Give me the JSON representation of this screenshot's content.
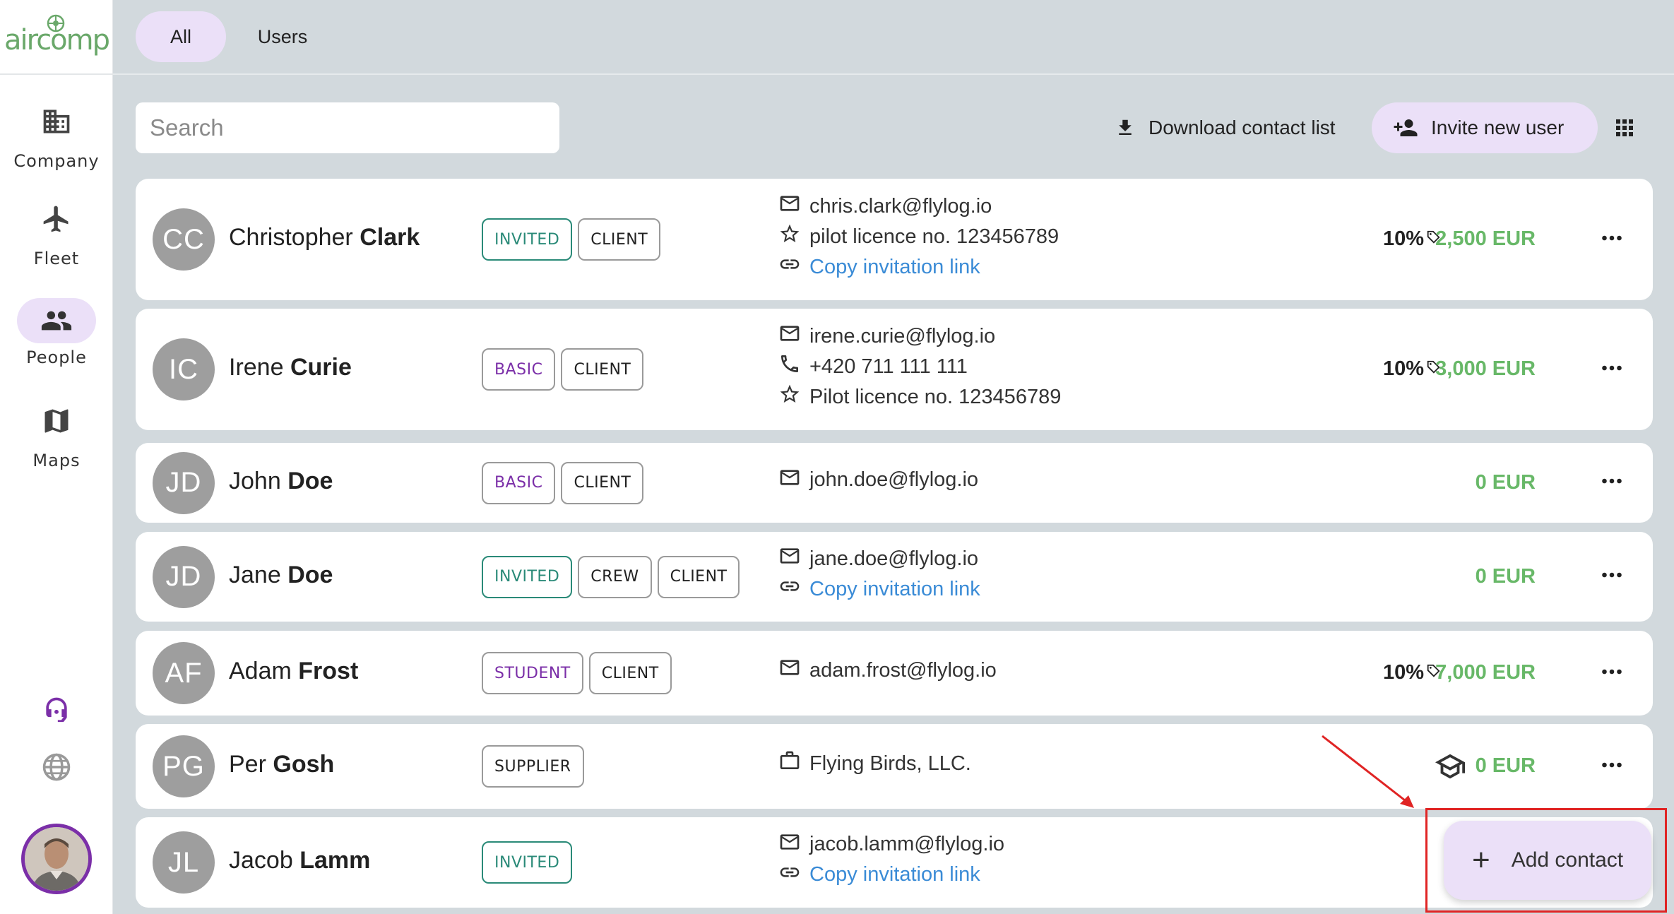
{
  "app": {
    "logo": "aircomp",
    "brand_color": "#6aa86a",
    "accent": "#ebe0f8"
  },
  "tabs": [
    {
      "label": "All",
      "active": true
    },
    {
      "label": "Users",
      "active": false
    }
  ],
  "sidebar": {
    "items": [
      {
        "label": "Company",
        "icon": "building-icon"
      },
      {
        "label": "Fleet",
        "icon": "airplane-icon"
      },
      {
        "label": "People",
        "icon": "people-icon",
        "active": true
      },
      {
        "label": "Maps",
        "icon": "map-icon"
      }
    ],
    "bottom_icons": [
      "support-icon",
      "globe-icon"
    ]
  },
  "search": {
    "placeholder": "Search",
    "value": ""
  },
  "toolbar": {
    "download_label": "Download contact list",
    "invite_label": "Invite new user"
  },
  "contacts": [
    {
      "initials": "CC",
      "first": "Christopher",
      "last": "Clark",
      "badges": [
        "INVITED",
        "CLIENT"
      ],
      "info": [
        {
          "icon": "mail-icon",
          "text": "chris.clark@flylog.io"
        },
        {
          "icon": "star-icon",
          "text": "pilot licence no. 123456789"
        },
        {
          "icon": "link-icon",
          "text": "Copy invitation link",
          "link": true
        }
      ],
      "discount": "10%",
      "amount": "2,500 EUR"
    },
    {
      "initials": "IC",
      "first": "Irene",
      "last": "Curie",
      "badges": [
        "BASIC",
        "CLIENT"
      ],
      "info": [
        {
          "icon": "mail-icon",
          "text": "irene.curie@flylog.io"
        },
        {
          "icon": "phone-icon",
          "text": "+420 711 111 111"
        },
        {
          "icon": "star-icon",
          "text": "Pilot licence no. 123456789"
        }
      ],
      "discount": "10%",
      "amount": "3,000 EUR"
    },
    {
      "initials": "JD",
      "first": "John",
      "last": "Doe",
      "badges": [
        "BASIC",
        "CLIENT"
      ],
      "info": [
        {
          "icon": "mail-icon",
          "text": "john.doe@flylog.io"
        }
      ],
      "discount": "",
      "amount": "0 EUR"
    },
    {
      "initials": "JD",
      "first": "Jane",
      "last": "Doe",
      "badges": [
        "INVITED",
        "CREW",
        "CLIENT"
      ],
      "info": [
        {
          "icon": "mail-icon",
          "text": "jane.doe@flylog.io"
        },
        {
          "icon": "link-icon",
          "text": "Copy invitation link",
          "link": true
        }
      ],
      "discount": "",
      "amount": "0 EUR"
    },
    {
      "initials": "AF",
      "first": "Adam",
      "last": "Frost",
      "badges": [
        "STUDENT",
        "CLIENT"
      ],
      "info": [
        {
          "icon": "mail-icon",
          "text": "adam.frost@flylog.io"
        }
      ],
      "discount": "10%",
      "amount": "7,000 EUR"
    },
    {
      "initials": "PG",
      "first": "Per",
      "last": "Gosh",
      "badges": [
        "SUPPLIER"
      ],
      "info": [
        {
          "icon": "briefcase-icon",
          "text": "Flying Birds, LLC."
        }
      ],
      "discount": "",
      "amount": "0 EUR",
      "extra_icon": "graduation-cap-icon"
    },
    {
      "initials": "JL",
      "first": "Jacob",
      "last": "Lamm",
      "badges": [
        "INVITED"
      ],
      "info": [
        {
          "icon": "mail-icon",
          "text": "jacob.lamm@flylog.io"
        },
        {
          "icon": "link-icon",
          "text": "Copy invitation link",
          "link": true
        }
      ],
      "discount": "",
      "amount": ""
    }
  ],
  "add_contact": {
    "label": "Add contact"
  }
}
